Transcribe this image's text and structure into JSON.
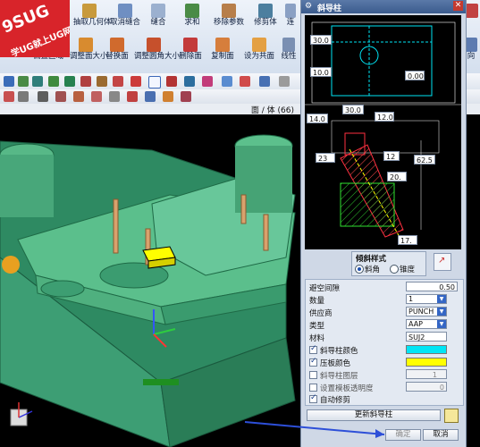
{
  "ribbon": {
    "row1": [
      {
        "label": "抽取几何体"
      },
      {
        "label": "取消缝合"
      },
      {
        "label": "缝合"
      },
      {
        "label": "求和"
      },
      {
        "label": "移除参数"
      },
      {
        "label": "修剪体"
      }
    ],
    "row2": [
      {
        "label": "偏置区域"
      },
      {
        "label": "调整面大小"
      },
      {
        "label": "替换面"
      },
      {
        "label": "调整圆角大小"
      },
      {
        "label": "删除面"
      },
      {
        "label": "复制面"
      },
      {
        "label": "设为共面"
      },
      {
        "label": "线性"
      }
    ],
    "right_row1": "连",
    "right_row2": "向"
  },
  "statusbar": {
    "face_label": "面 / 体 (66)"
  },
  "logo": {
    "line1": "9SUG",
    "line2": "学UG就上UG网"
  },
  "dialog": {
    "title": "斜导柱",
    "preview_dims": {
      "d1": "30.0",
      "d2": "10.0",
      "d3": "0.00",
      "d4": "14.0",
      "d5": "30.0",
      "d6": "12.0",
      "d7": "23",
      "d8": "12",
      "d9": "62.5",
      "d10": "20.",
      "d11": "17."
    },
    "style_group": "倾斜样式",
    "radio_bevel": "斜角",
    "radio_taper": "锥度",
    "fields": {
      "clearance_label": "避空间隙",
      "clearance_value": "0.50",
      "qty_label": "数量",
      "qty_value": "1",
      "supplier_label": "供应商",
      "supplier_value": "PUNCH",
      "type_label": "类型",
      "type_value": "AAP",
      "material_label": "材料",
      "material_value": "SUJ2"
    },
    "check_color": "斜导柱颜色",
    "check_plate": "压板颜色",
    "check_layer": "斜导柱图层",
    "layer_value": "1",
    "check_transparency": "设置模板透明度",
    "transparency_value": "0",
    "check_auto": "自动修剪",
    "update_button": "更新斜导柱",
    "ok_button": "确定",
    "cancel_button": "取消",
    "color_cyan": "#00e5f5",
    "color_yellow": "#ffff00"
  }
}
